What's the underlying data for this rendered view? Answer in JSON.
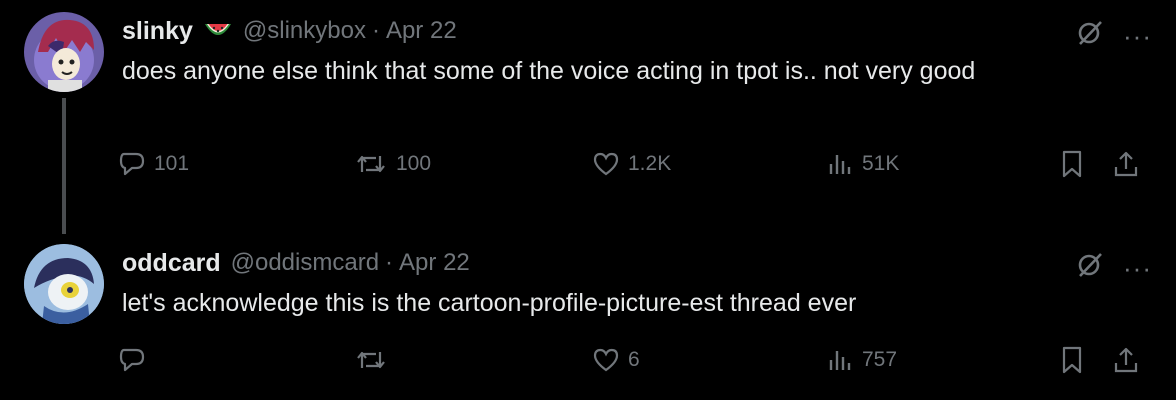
{
  "tweets": [
    {
      "name": "slinky",
      "badge_icon": "watermelon-icon",
      "handle": "@slinkybox",
      "separator": "·",
      "date": "Apr 22",
      "text": "does anyone else think that some of the voice acting in tpot is.. not very good",
      "more": "···",
      "stats": {
        "replies": "101",
        "retweets": "100",
        "likes": "1.2K",
        "views": "51K"
      }
    },
    {
      "name": "oddcard",
      "handle": "@oddismcard",
      "separator": "·",
      "date": "Apr 22",
      "text": "let's acknowledge this is the cartoon-profile-picture-est thread ever",
      "more": "···",
      "stats": {
        "replies": "",
        "retweets": "",
        "likes": "6",
        "views": "757"
      }
    }
  ],
  "colors": {
    "background": "#000000",
    "text": "#e7e9ea",
    "muted": "#71767b",
    "thread_line": "#4a4d50"
  }
}
